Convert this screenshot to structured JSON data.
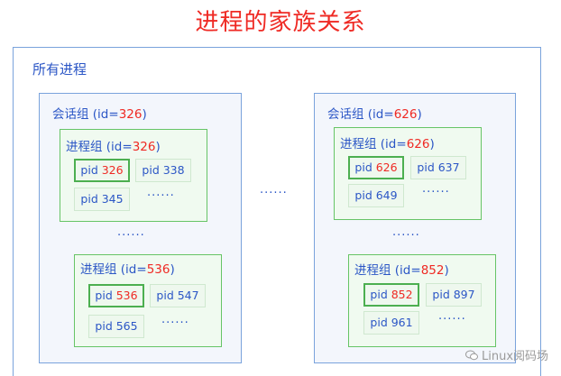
{
  "title": "进程的家族关系",
  "all_processes": {
    "label": "所有进程"
  },
  "sessions": [
    {
      "label_prefix": "会话组 (id=",
      "label_id": "326",
      "label_suffix": ")",
      "groups": [
        {
          "label_prefix": "进程组 (id=",
          "label_id": "326",
          "label_suffix": ")",
          "pids": [
            {
              "prefix": "pid ",
              "value": "326",
              "leader": true
            },
            {
              "prefix": "pid ",
              "value": "338",
              "leader": false
            },
            {
              "prefix": "pid ",
              "value": "345",
              "leader": false
            }
          ],
          "ellipsis": "······"
        },
        {
          "label_prefix": "进程组 (id=",
          "label_id": "536",
          "label_suffix": ")",
          "pids": [
            {
              "prefix": "pid ",
              "value": "536",
              "leader": true
            },
            {
              "prefix": "pid ",
              "value": "547",
              "leader": false
            },
            {
              "prefix": "pid ",
              "value": "565",
              "leader": false
            }
          ],
          "ellipsis": "······"
        }
      ],
      "between_groups_ellipsis": "······"
    },
    {
      "label_prefix": "会话组 (id=",
      "label_id": "626",
      "label_suffix": ")",
      "groups": [
        {
          "label_prefix": "进程组 (id=",
          "label_id": "626",
          "label_suffix": ")",
          "pids": [
            {
              "prefix": "pid ",
              "value": "626",
              "leader": true
            },
            {
              "prefix": "pid ",
              "value": "637",
              "leader": false
            },
            {
              "prefix": "pid ",
              "value": "649",
              "leader": false
            }
          ],
          "ellipsis": "······"
        },
        {
          "label_prefix": "进程组 (id=",
          "label_id": "852",
          "label_suffix": ")",
          "pids": [
            {
              "prefix": "pid ",
              "value": "852",
              "leader": true
            },
            {
              "prefix": "pid ",
              "value": "897",
              "leader": false
            },
            {
              "prefix": "pid ",
              "value": "961",
              "leader": false
            }
          ],
          "ellipsis": "······"
        }
      ],
      "between_groups_ellipsis": "······"
    }
  ],
  "between_sessions_ellipsis": "······",
  "watermark": {
    "text": "Linux阅码场",
    "icon": "wechat-icon"
  },
  "colors": {
    "title": "#ef2a24",
    "highlight_id": "#ef2a24",
    "text": "#2b56c6",
    "session_border": "#7aa3dc",
    "group_border": "#66c466",
    "leader_border": "#4caf50"
  }
}
